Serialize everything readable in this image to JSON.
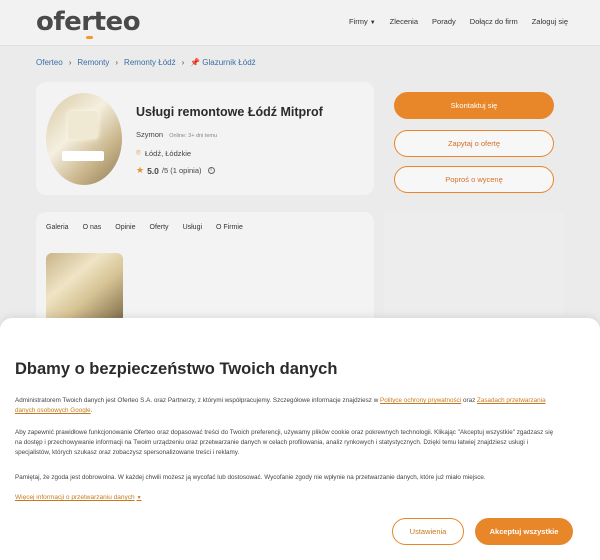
{
  "header": {
    "logo": "oferteo",
    "nav": [
      "Firmy",
      "Zlecenia",
      "Porady",
      "Dołącz do firm",
      "Zaloguj się"
    ]
  },
  "breadcrumb": [
    "Oferteo",
    "Remonty",
    "Remonty Łódź",
    "Glazurnik Łódź"
  ],
  "profile": {
    "title": "Usługi remontowe Łódź Mitprof",
    "owner": "Szymon",
    "online": "Online: 3+ dni temu",
    "location": "Łódź, Łódzkie",
    "rating_value": "5.0",
    "rating_suffix": "/5 (1 opinia)"
  },
  "actions": {
    "contact": "Skontaktuj się",
    "ask_offer": "Zapytaj o ofertę",
    "ask_quote": "Poproś o wycenę"
  },
  "tabs": [
    "Galeria",
    "O nas",
    "Opinie",
    "Oferty",
    "Usługi",
    "O Firmie"
  ],
  "consent": {
    "title": "Dbamy o bezpieczeństwo Twoich danych",
    "p1_text": "Administratorem Twoich danych jest Oferteo S.A. oraz Partnerzy, z którymi współpracujemy. Szczegółowe informacje znajdziesz w ",
    "p1_link1": "Polityce ochrony prywatności",
    "p1_mid": " oraz ",
    "p1_link2": "Zasadach przetwarzania danych osobowych Google",
    "p1_end": ".",
    "p2": "Aby zapewnić prawidłowe funkcjonowanie Oferteo oraz dopasować treści do Twoich preferencji, używamy plików cookie oraz pokrewnych technologii. Klikając \"Akceptuj wszystkie\" zgadzasz się na dostęp i przechowywanie informacji na Twoim urządzeniu oraz przetwarzanie danych w celach profilowania, analiz rynkowych i statystycznych. Dzięki temu łatwiej znajdziesz usługi i specjalistów, których szukasz oraz zobaczysz spersonalizowane treści i reklamy.",
    "p3": "Pamiętaj, że zgoda jest dobrowolna. W każdej chwili możesz ją wycofać lub dostosować. Wycofanie zgody nie wpłynie na przetwarzanie danych, które już miało miejsce.",
    "more": "Więcej informacji o przetwarzaniu danych",
    "settings": "Ustawienia",
    "accept": "Akceptuj wszystkie"
  }
}
